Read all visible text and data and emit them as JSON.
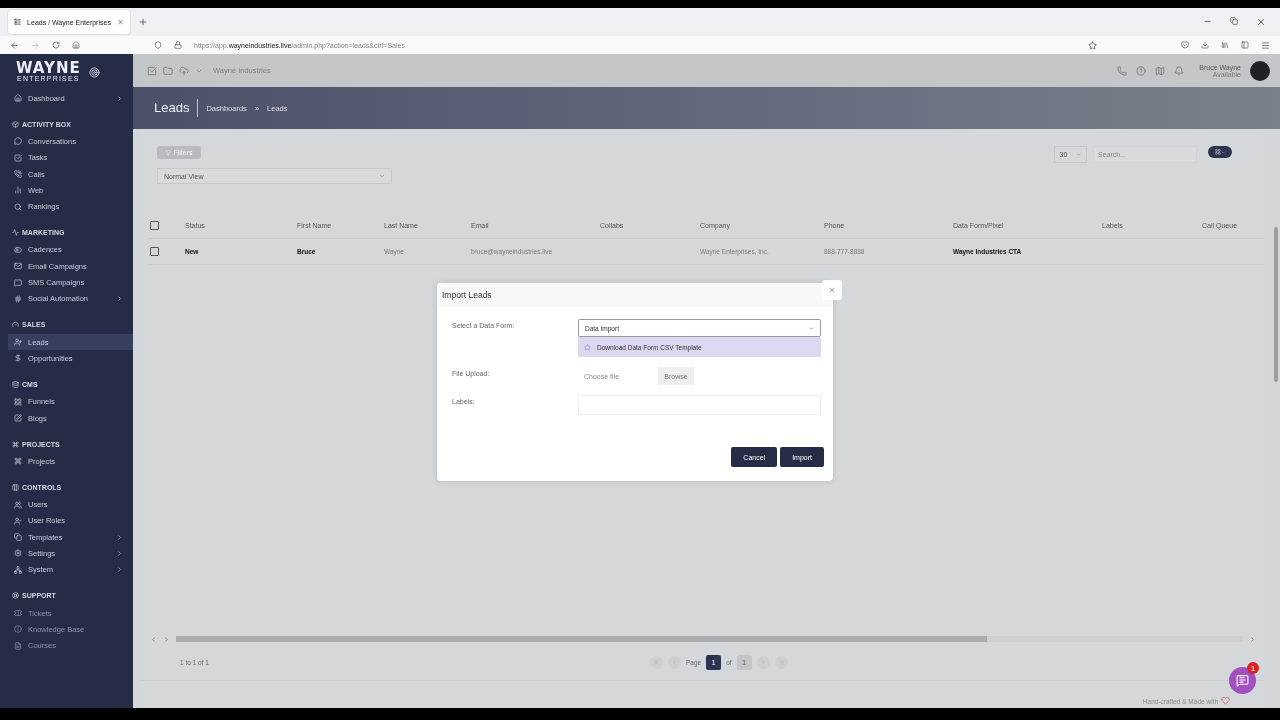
{
  "browser": {
    "tab": {
      "title": "Leads / Wayne Enterprises"
    },
    "url": "https://app.**wayneindustries.live**/admin.php?action=leads&ctrl=Sales"
  },
  "logo": {
    "name": "WAYNE",
    "tagline": "ENTERPRISES"
  },
  "sidebar": {
    "items": [
      {
        "label": "Dashboard",
        "selected": false,
        "expandable": true
      }
    ],
    "sections": [
      {
        "title": "ACTIVITY BOX",
        "items": [
          {
            "label": "Conversations",
            "selected": false,
            "expandable": false
          },
          {
            "label": "Tasks",
            "selected": false,
            "expandable": false
          },
          {
            "label": "Calls",
            "selected": false,
            "expandable": false
          },
          {
            "label": "Web",
            "selected": false,
            "expandable": false
          },
          {
            "label": "Rankings",
            "selected": false,
            "expandable": false
          }
        ]
      },
      {
        "title": "MARKETING",
        "items": [
          {
            "label": "Cadences",
            "selected": false,
            "expandable": false
          },
          {
            "label": "Email Campaigns",
            "selected": false,
            "expandable": false
          },
          {
            "label": "SMS Campaigns",
            "selected": false,
            "expandable": false
          },
          {
            "label": "Social Automation",
            "selected": false,
            "expandable": true
          }
        ]
      },
      {
        "title": "SALES",
        "items": [
          {
            "label": "Leads",
            "selected": true,
            "expandable": false
          },
          {
            "label": "Opportunities",
            "selected": false,
            "expandable": false
          }
        ]
      },
      {
        "title": "CMS",
        "items": [
          {
            "label": "Funnels",
            "selected": false,
            "expandable": false
          },
          {
            "label": "Blogs",
            "selected": false,
            "expandable": false
          }
        ]
      },
      {
        "title": "PROJECTS",
        "items": [
          {
            "label": "Projects",
            "selected": false,
            "expandable": false
          }
        ]
      },
      {
        "title": "CONTROLS",
        "items": [
          {
            "label": "Users",
            "selected": false,
            "expandable": false
          },
          {
            "label": "User Roles",
            "selected": false,
            "expandable": false
          },
          {
            "label": "Templates",
            "selected": false,
            "expandable": true
          },
          {
            "label": "Settings",
            "selected": false,
            "expandable": true
          },
          {
            "label": "System",
            "selected": false,
            "expandable": true
          }
        ]
      },
      {
        "title": "SUPPORT",
        "items": [
          {
            "label": "Tickets",
            "selected": false,
            "expandable": false
          },
          {
            "label": "Knowledge Base",
            "selected": false,
            "expandable": false
          },
          {
            "label": "Courses",
            "selected": false,
            "expandable": false
          }
        ]
      }
    ]
  },
  "topbar": {
    "workspace": "Wayne Industries",
    "user": {
      "name": "Bruce Wayne",
      "status": "Available"
    }
  },
  "page": {
    "title": "Leads",
    "breadcrumbs": [
      "Dashboards",
      "Leads"
    ],
    "breadcrumb_separator": "»"
  },
  "toolbar": {
    "filter_button": "Filters",
    "view": "Normal View",
    "page_size": "30",
    "search": {
      "placeholder": "Search..."
    }
  },
  "table": {
    "header_checked": false,
    "columns": [
      "Status",
      "First Name",
      "Last Name",
      "Email",
      "Collabs",
      "Company",
      "Phone",
      "Data Form/Pixel",
      "Labels",
      "Call Queue"
    ],
    "rows": [
      {
        "checked": false,
        "status": {
          "text": "New",
          "strong": true
        },
        "first_name": {
          "text": "Bruce",
          "strong": true
        },
        "last_name": {
          "text": "Wayne",
          "strong": false
        },
        "email": {
          "text": "bruce@wayneindustries.live",
          "strong": false
        },
        "company": {
          "text": "Wayne Enterprises, Inc.",
          "strong": false
        },
        "phone": {
          "text": "888-777-8888",
          "strong": false
        },
        "data_form": {
          "text": "Wayne Industries CTA",
          "strong": true
        }
      }
    ]
  },
  "pagination": {
    "summary": "1 to 1 of 1",
    "page_label": "Page",
    "page": "1",
    "of_label": "of",
    "total": "1"
  },
  "dialog": {
    "title": "Import Leads",
    "fields": [
      {
        "kind": "select",
        "label": "Select a Data Form:",
        "value": "Data Import",
        "expanded": true,
        "option": "Download Data Form CSV Template"
      },
      {
        "kind": "file",
        "label": "File Upload:",
        "placeholder": "Choose file",
        "button": "Browse"
      },
      {
        "kind": "tags",
        "label": "Labels:"
      }
    ],
    "buttons": [
      "Cancel",
      "Import"
    ]
  },
  "footer": {
    "text": "Hand-crafted & Made with"
  },
  "chat": {
    "badge": "1"
  }
}
